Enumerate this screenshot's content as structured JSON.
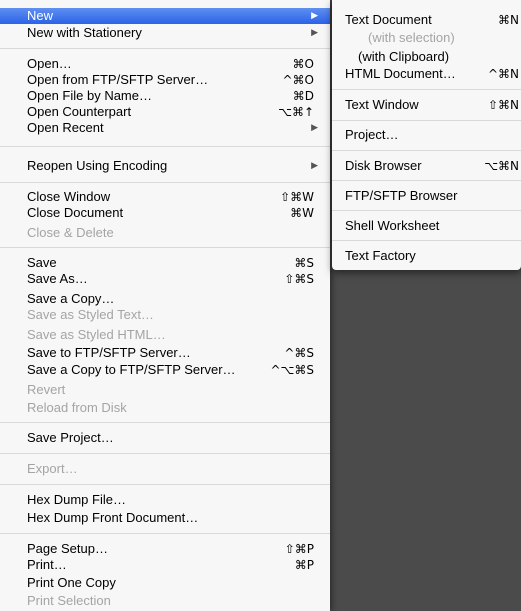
{
  "menu": {
    "rows": [
      {
        "label": "New",
        "arrow": "▶"
      },
      {
        "label": "New with Stationery",
        "arrow": "▶"
      },
      {
        "label": "Open…",
        "shortcut": "⌘O"
      },
      {
        "label": "Open from FTP/SFTP Server…",
        "shortcut": "^⌘O"
      },
      {
        "label": "Open File by Name…",
        "shortcut": "⌘D"
      },
      {
        "label": "Open Counterpart",
        "shortcut": "⌥⌘↑"
      },
      {
        "label": "Open Recent",
        "arrow": "▶"
      },
      {
        "label": "Reopen Using Encoding",
        "arrow": "▶"
      },
      {
        "label": "Close Window",
        "shortcut": "⇧⌘W"
      },
      {
        "label": "Close Document",
        "shortcut": "⌘W"
      },
      {
        "label": "Close & Delete"
      },
      {
        "label": "Save",
        "shortcut": "⌘S"
      },
      {
        "label": "Save As…",
        "shortcut": "⇧⌘S"
      },
      {
        "label": "Save a Copy…"
      },
      {
        "label": "Save as Styled Text…"
      },
      {
        "label": "Save as Styled HTML…"
      },
      {
        "label": "Save to FTP/SFTP Server…",
        "shortcut": "^⌘S"
      },
      {
        "label": "Save a Copy to FTP/SFTP Server…",
        "shortcut": "^⌥⌘S"
      },
      {
        "label": "Revert"
      },
      {
        "label": "Reload from Disk"
      },
      {
        "label": "Save Project…"
      },
      {
        "label": "Export…"
      },
      {
        "label": "Hex Dump File…"
      },
      {
        "label": "Hex Dump Front Document…"
      },
      {
        "label": "Page Setup…",
        "shortcut": "⇧⌘P"
      },
      {
        "label": "Print…",
        "shortcut": "⌘P"
      },
      {
        "label": "Print One Copy"
      },
      {
        "label": "Print Selection"
      }
    ]
  },
  "submenu": {
    "rows": [
      {
        "label": "Text Document",
        "shortcut": "⌘N"
      },
      {
        "label": "(with selection)"
      },
      {
        "label": "(with Clipboard)"
      },
      {
        "label": "HTML Document…",
        "shortcut": "^⌘N"
      },
      {
        "label": "Text Window",
        "shortcut": "⇧⌘N"
      },
      {
        "label": "Project…"
      },
      {
        "label": "Disk Browser",
        "shortcut": "⌥⌘N"
      },
      {
        "label": "FTP/SFTP Browser"
      },
      {
        "label": "Shell Worksheet"
      },
      {
        "label": "Text Factory"
      }
    ]
  }
}
